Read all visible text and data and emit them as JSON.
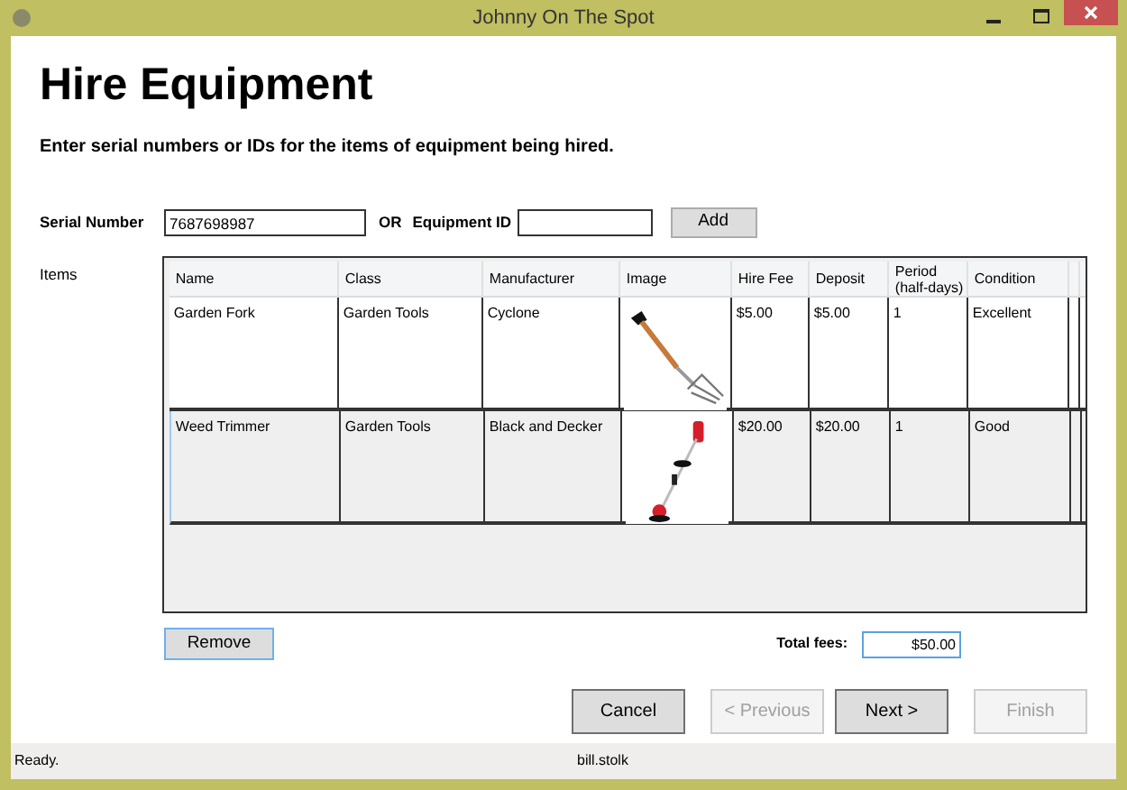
{
  "window": {
    "title": "Johnny On The Spot"
  },
  "heading": "Hire Equipment",
  "instructions": "Enter serial numbers or IDs for the items of equipment being hired.",
  "serial": {
    "label": "Serial Number",
    "value": "7687698987"
  },
  "or_label": "OR",
  "equipment_id": {
    "label": "Equipment ID"
  },
  "add_button": "Add",
  "items_label": "Items",
  "table": {
    "columns": [
      "Name",
      "Class",
      "Manufacturer",
      "Image",
      "Hire Fee",
      "Deposit",
      "Period\n(half-days)",
      "Condition"
    ],
    "rows": [
      {
        "selected": false,
        "cells": [
          "Garden Fork",
          "Garden Tools",
          "Cyclone",
          null,
          "$5.00",
          "$5.00",
          "1",
          "Excellent"
        ]
      },
      {
        "selected": true,
        "cells": [
          "Weed Trimmer",
          "Garden Tools",
          "Black and Decker",
          null,
          "$20.00",
          "$20.00",
          "1",
          "Good"
        ]
      }
    ]
  },
  "remove_button": "Remove",
  "total": {
    "label": "Total fees:",
    "value": "$50.00"
  },
  "buttons": [
    {
      "label": "Cancel",
      "disabled": false
    },
    {
      "label": "< Previous",
      "disabled": true
    },
    {
      "label": "Next >",
      "disabled": false
    },
    {
      "label": "Finish",
      "disabled": true
    }
  ],
  "status_bar": {
    "message": "Ready.",
    "user": "bill.stolk"
  }
}
